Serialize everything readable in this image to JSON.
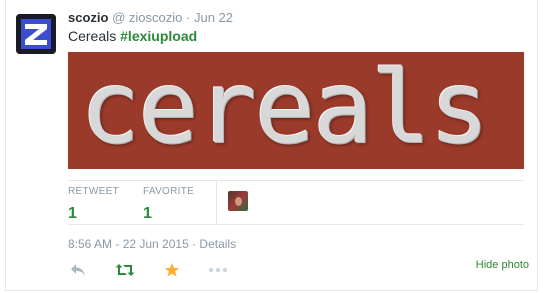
{
  "tweet": {
    "fullname": "scozio",
    "handle": "@ zioscozio",
    "separator": "·",
    "date": "Jun 22",
    "text_plain": "Cereals ",
    "hashtag": "#lexiupload",
    "photo_text": "cereals"
  },
  "stats": {
    "retweet_label": "RETWEET",
    "retweet_count": "1",
    "favorite_label": "FAVORITE",
    "favorite_count": "1"
  },
  "timestamp": "8:56 AM - 22 Jun 2015 · Details",
  "actions": {
    "reply_icon": "reply-icon",
    "retweet_icon": "retweet-icon",
    "favorite_icon": "star-icon",
    "more_icon": "more-icon",
    "hide_photo_label": "Hide photo"
  },
  "colors": {
    "accent_green": "#2a8a3a",
    "favorite_gold": "#ffac33",
    "muted": "#8899a6",
    "photo_bg": "#9a3a2a"
  }
}
